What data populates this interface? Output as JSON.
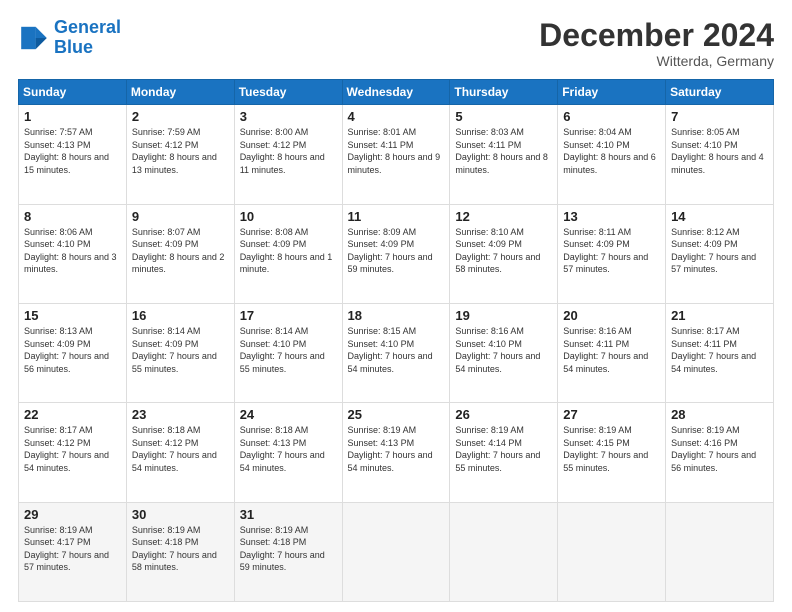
{
  "header": {
    "logo_line1": "General",
    "logo_line2": "Blue",
    "month": "December 2024",
    "location": "Witterda, Germany"
  },
  "weekdays": [
    "Sunday",
    "Monday",
    "Tuesday",
    "Wednesday",
    "Thursday",
    "Friday",
    "Saturday"
  ],
  "weeks": [
    [
      {
        "day": "1",
        "sunrise": "7:57 AM",
        "sunset": "4:13 PM",
        "daylight": "8 hours and 15 minutes."
      },
      {
        "day": "2",
        "sunrise": "7:59 AM",
        "sunset": "4:12 PM",
        "daylight": "8 hours and 13 minutes."
      },
      {
        "day": "3",
        "sunrise": "8:00 AM",
        "sunset": "4:12 PM",
        "daylight": "8 hours and 11 minutes."
      },
      {
        "day": "4",
        "sunrise": "8:01 AM",
        "sunset": "4:11 PM",
        "daylight": "8 hours and 9 minutes."
      },
      {
        "day": "5",
        "sunrise": "8:03 AM",
        "sunset": "4:11 PM",
        "daylight": "8 hours and 8 minutes."
      },
      {
        "day": "6",
        "sunrise": "8:04 AM",
        "sunset": "4:10 PM",
        "daylight": "8 hours and 6 minutes."
      },
      {
        "day": "7",
        "sunrise": "8:05 AM",
        "sunset": "4:10 PM",
        "daylight": "8 hours and 4 minutes."
      }
    ],
    [
      {
        "day": "8",
        "sunrise": "8:06 AM",
        "sunset": "4:10 PM",
        "daylight": "8 hours and 3 minutes."
      },
      {
        "day": "9",
        "sunrise": "8:07 AM",
        "sunset": "4:09 PM",
        "daylight": "8 hours and 2 minutes."
      },
      {
        "day": "10",
        "sunrise": "8:08 AM",
        "sunset": "4:09 PM",
        "daylight": "8 hours and 1 minute."
      },
      {
        "day": "11",
        "sunrise": "8:09 AM",
        "sunset": "4:09 PM",
        "daylight": "7 hours and 59 minutes."
      },
      {
        "day": "12",
        "sunrise": "8:10 AM",
        "sunset": "4:09 PM",
        "daylight": "7 hours and 58 minutes."
      },
      {
        "day": "13",
        "sunrise": "8:11 AM",
        "sunset": "4:09 PM",
        "daylight": "7 hours and 57 minutes."
      },
      {
        "day": "14",
        "sunrise": "8:12 AM",
        "sunset": "4:09 PM",
        "daylight": "7 hours and 57 minutes."
      }
    ],
    [
      {
        "day": "15",
        "sunrise": "8:13 AM",
        "sunset": "4:09 PM",
        "daylight": "7 hours and 56 minutes."
      },
      {
        "day": "16",
        "sunrise": "8:14 AM",
        "sunset": "4:09 PM",
        "daylight": "7 hours and 55 minutes."
      },
      {
        "day": "17",
        "sunrise": "8:14 AM",
        "sunset": "4:10 PM",
        "daylight": "7 hours and 55 minutes."
      },
      {
        "day": "18",
        "sunrise": "8:15 AM",
        "sunset": "4:10 PM",
        "daylight": "7 hours and 54 minutes."
      },
      {
        "day": "19",
        "sunrise": "8:16 AM",
        "sunset": "4:10 PM",
        "daylight": "7 hours and 54 minutes."
      },
      {
        "day": "20",
        "sunrise": "8:16 AM",
        "sunset": "4:11 PM",
        "daylight": "7 hours and 54 minutes."
      },
      {
        "day": "21",
        "sunrise": "8:17 AM",
        "sunset": "4:11 PM",
        "daylight": "7 hours and 54 minutes."
      }
    ],
    [
      {
        "day": "22",
        "sunrise": "8:17 AM",
        "sunset": "4:12 PM",
        "daylight": "7 hours and 54 minutes."
      },
      {
        "day": "23",
        "sunrise": "8:18 AM",
        "sunset": "4:12 PM",
        "daylight": "7 hours and 54 minutes."
      },
      {
        "day": "24",
        "sunrise": "8:18 AM",
        "sunset": "4:13 PM",
        "daylight": "7 hours and 54 minutes."
      },
      {
        "day": "25",
        "sunrise": "8:19 AM",
        "sunset": "4:13 PM",
        "daylight": "7 hours and 54 minutes."
      },
      {
        "day": "26",
        "sunrise": "8:19 AM",
        "sunset": "4:14 PM",
        "daylight": "7 hours and 55 minutes."
      },
      {
        "day": "27",
        "sunrise": "8:19 AM",
        "sunset": "4:15 PM",
        "daylight": "7 hours and 55 minutes."
      },
      {
        "day": "28",
        "sunrise": "8:19 AM",
        "sunset": "4:16 PM",
        "daylight": "7 hours and 56 minutes."
      }
    ],
    [
      {
        "day": "29",
        "sunrise": "8:19 AM",
        "sunset": "4:17 PM",
        "daylight": "7 hours and 57 minutes."
      },
      {
        "day": "30",
        "sunrise": "8:19 AM",
        "sunset": "4:18 PM",
        "daylight": "7 hours and 58 minutes."
      },
      {
        "day": "31",
        "sunrise": "8:19 AM",
        "sunset": "4:18 PM",
        "daylight": "7 hours and 59 minutes."
      },
      null,
      null,
      null,
      null
    ]
  ]
}
